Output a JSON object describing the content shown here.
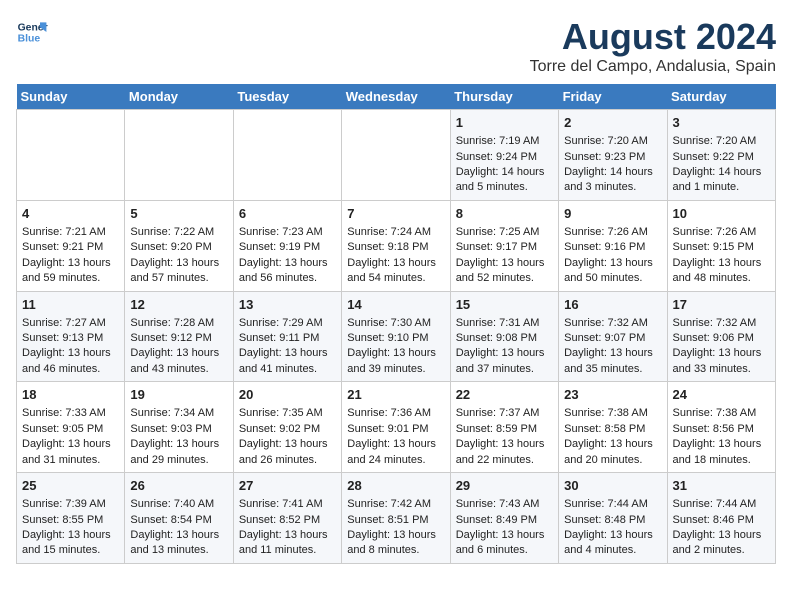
{
  "header": {
    "logo_line1": "General",
    "logo_line2": "Blue",
    "title": "August 2024",
    "subtitle": "Torre del Campo, Andalusia, Spain"
  },
  "calendar": {
    "headers": [
      "Sunday",
      "Monday",
      "Tuesday",
      "Wednesday",
      "Thursday",
      "Friday",
      "Saturday"
    ],
    "weeks": [
      [
        {
          "day": "",
          "info": ""
        },
        {
          "day": "",
          "info": ""
        },
        {
          "day": "",
          "info": ""
        },
        {
          "day": "",
          "info": ""
        },
        {
          "day": "1",
          "info": "Sunrise: 7:19 AM\nSunset: 9:24 PM\nDaylight: 14 hours\nand 5 minutes."
        },
        {
          "day": "2",
          "info": "Sunrise: 7:20 AM\nSunset: 9:23 PM\nDaylight: 14 hours\nand 3 minutes."
        },
        {
          "day": "3",
          "info": "Sunrise: 7:20 AM\nSunset: 9:22 PM\nDaylight: 14 hours\nand 1 minute."
        }
      ],
      [
        {
          "day": "4",
          "info": "Sunrise: 7:21 AM\nSunset: 9:21 PM\nDaylight: 13 hours\nand 59 minutes."
        },
        {
          "day": "5",
          "info": "Sunrise: 7:22 AM\nSunset: 9:20 PM\nDaylight: 13 hours\nand 57 minutes."
        },
        {
          "day": "6",
          "info": "Sunrise: 7:23 AM\nSunset: 9:19 PM\nDaylight: 13 hours\nand 56 minutes."
        },
        {
          "day": "7",
          "info": "Sunrise: 7:24 AM\nSunset: 9:18 PM\nDaylight: 13 hours\nand 54 minutes."
        },
        {
          "day": "8",
          "info": "Sunrise: 7:25 AM\nSunset: 9:17 PM\nDaylight: 13 hours\nand 52 minutes."
        },
        {
          "day": "9",
          "info": "Sunrise: 7:26 AM\nSunset: 9:16 PM\nDaylight: 13 hours\nand 50 minutes."
        },
        {
          "day": "10",
          "info": "Sunrise: 7:26 AM\nSunset: 9:15 PM\nDaylight: 13 hours\nand 48 minutes."
        }
      ],
      [
        {
          "day": "11",
          "info": "Sunrise: 7:27 AM\nSunset: 9:13 PM\nDaylight: 13 hours\nand 46 minutes."
        },
        {
          "day": "12",
          "info": "Sunrise: 7:28 AM\nSunset: 9:12 PM\nDaylight: 13 hours\nand 43 minutes."
        },
        {
          "day": "13",
          "info": "Sunrise: 7:29 AM\nSunset: 9:11 PM\nDaylight: 13 hours\nand 41 minutes."
        },
        {
          "day": "14",
          "info": "Sunrise: 7:30 AM\nSunset: 9:10 PM\nDaylight: 13 hours\nand 39 minutes."
        },
        {
          "day": "15",
          "info": "Sunrise: 7:31 AM\nSunset: 9:08 PM\nDaylight: 13 hours\nand 37 minutes."
        },
        {
          "day": "16",
          "info": "Sunrise: 7:32 AM\nSunset: 9:07 PM\nDaylight: 13 hours\nand 35 minutes."
        },
        {
          "day": "17",
          "info": "Sunrise: 7:32 AM\nSunset: 9:06 PM\nDaylight: 13 hours\nand 33 minutes."
        }
      ],
      [
        {
          "day": "18",
          "info": "Sunrise: 7:33 AM\nSunset: 9:05 PM\nDaylight: 13 hours\nand 31 minutes."
        },
        {
          "day": "19",
          "info": "Sunrise: 7:34 AM\nSunset: 9:03 PM\nDaylight: 13 hours\nand 29 minutes."
        },
        {
          "day": "20",
          "info": "Sunrise: 7:35 AM\nSunset: 9:02 PM\nDaylight: 13 hours\nand 26 minutes."
        },
        {
          "day": "21",
          "info": "Sunrise: 7:36 AM\nSunset: 9:01 PM\nDaylight: 13 hours\nand 24 minutes."
        },
        {
          "day": "22",
          "info": "Sunrise: 7:37 AM\nSunset: 8:59 PM\nDaylight: 13 hours\nand 22 minutes."
        },
        {
          "day": "23",
          "info": "Sunrise: 7:38 AM\nSunset: 8:58 PM\nDaylight: 13 hours\nand 20 minutes."
        },
        {
          "day": "24",
          "info": "Sunrise: 7:38 AM\nSunset: 8:56 PM\nDaylight: 13 hours\nand 18 minutes."
        }
      ],
      [
        {
          "day": "25",
          "info": "Sunrise: 7:39 AM\nSunset: 8:55 PM\nDaylight: 13 hours\nand 15 minutes."
        },
        {
          "day": "26",
          "info": "Sunrise: 7:40 AM\nSunset: 8:54 PM\nDaylight: 13 hours\nand 13 minutes."
        },
        {
          "day": "27",
          "info": "Sunrise: 7:41 AM\nSunset: 8:52 PM\nDaylight: 13 hours\nand 11 minutes."
        },
        {
          "day": "28",
          "info": "Sunrise: 7:42 AM\nSunset: 8:51 PM\nDaylight: 13 hours\nand 8 minutes."
        },
        {
          "day": "29",
          "info": "Sunrise: 7:43 AM\nSunset: 8:49 PM\nDaylight: 13 hours\nand 6 minutes."
        },
        {
          "day": "30",
          "info": "Sunrise: 7:44 AM\nSunset: 8:48 PM\nDaylight: 13 hours\nand 4 minutes."
        },
        {
          "day": "31",
          "info": "Sunrise: 7:44 AM\nSunset: 8:46 PM\nDaylight: 13 hours\nand 2 minutes."
        }
      ]
    ]
  }
}
